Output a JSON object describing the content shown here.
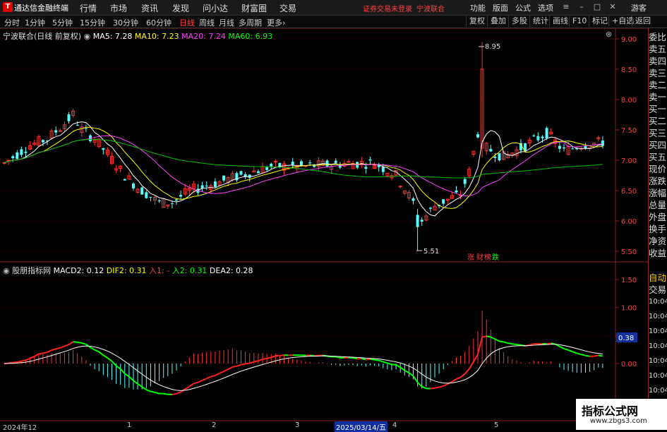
{
  "app": {
    "logo": "T",
    "title": "通达信金融终端",
    "menus": [
      "行情",
      "市场",
      "资讯",
      "发现",
      "问小达",
      "财富圈",
      "交易"
    ],
    "login_warning": "证券交易未登录",
    "stock_name": "宁波联合",
    "right_menus": [
      "功能",
      "版面",
      "公式",
      "选项"
    ],
    "guest": "游客"
  },
  "periods": {
    "items": [
      "分时",
      "1分钟",
      "5分钟",
      "15分钟",
      "30分钟",
      "60分钟",
      "日线",
      "周线",
      "月线",
      "多周期",
      "更多"
    ],
    "active": "日线",
    "more_suffix": "›"
  },
  "toolbar": [
    "复权",
    "叠加",
    "多股",
    "统计",
    "画线",
    "F10",
    "标记",
    "+自选",
    "返回"
  ],
  "info": {
    "title": "宁波联合(日线 前复权)",
    "ma": [
      {
        "label": "MA5: 7.28",
        "color": "#ffffff"
      },
      {
        "label": "MA10: 7.23",
        "color": "#ffff00"
      },
      {
        "label": "MA20: 7.24",
        "color": "#ff40ff"
      },
      {
        "label": "MA60: 6.93",
        "color": "#00ff00"
      }
    ]
  },
  "price_axis": [
    "9.00",
    "8.50",
    "8.00",
    "7.50",
    "7.00",
    "6.50",
    "6.00",
    "5.50"
  ],
  "price_annotations": {
    "high": "8.95",
    "low": "5.51",
    "tag1": "涨",
    "tag2": "财",
    "tag3": "榜",
    "tag4": "跌"
  },
  "right_panel": [
    "委比",
    "卖五",
    "卖四",
    "卖三",
    "卖二",
    "卖一",
    "买一",
    "买二",
    "买三",
    "买四",
    "买五",
    "现价",
    "涨跌",
    "涨幅",
    "总量",
    "外盘",
    "换手",
    "净资",
    "收益"
  ],
  "right_panel_lower": [
    "自动",
    "交易",
    "10:04",
    "10:04",
    "10:04",
    "10:04",
    "10:04",
    "10:04",
    "10:04",
    "10:04"
  ],
  "macd": {
    "name": "股朋指标网",
    "macd2": "MACD2: 0.12",
    "dif2": "DIF2: 0.31",
    "in1": "入1: -",
    "in2": "入2: 0.31",
    "dea2": "DEA2: 0.28",
    "axis": [
      "1.50",
      "1.00",
      "0.50",
      "0.00"
    ],
    "current": "0.38"
  },
  "dates": [
    "2024年12",
    "1",
    "2",
    "3",
    "4",
    "5"
  ],
  "date_highlight": "2025/03/14/五",
  "watermark": {
    "big": "指标公式网",
    "small": "www.zbgs3.com"
  },
  "colors": {
    "up": "#ff3030",
    "down": "#54ffff",
    "ma60": "#00c000"
  },
  "chart_data": {
    "type": "candlestick",
    "ylim": [
      5.4,
      9.1
    ],
    "ma_current": {
      "MA5": 7.28,
      "MA10": 7.23,
      "MA20": 7.24,
      "MA60": 6.93
    },
    "high_label": 8.95,
    "low_label": 5.51
  }
}
